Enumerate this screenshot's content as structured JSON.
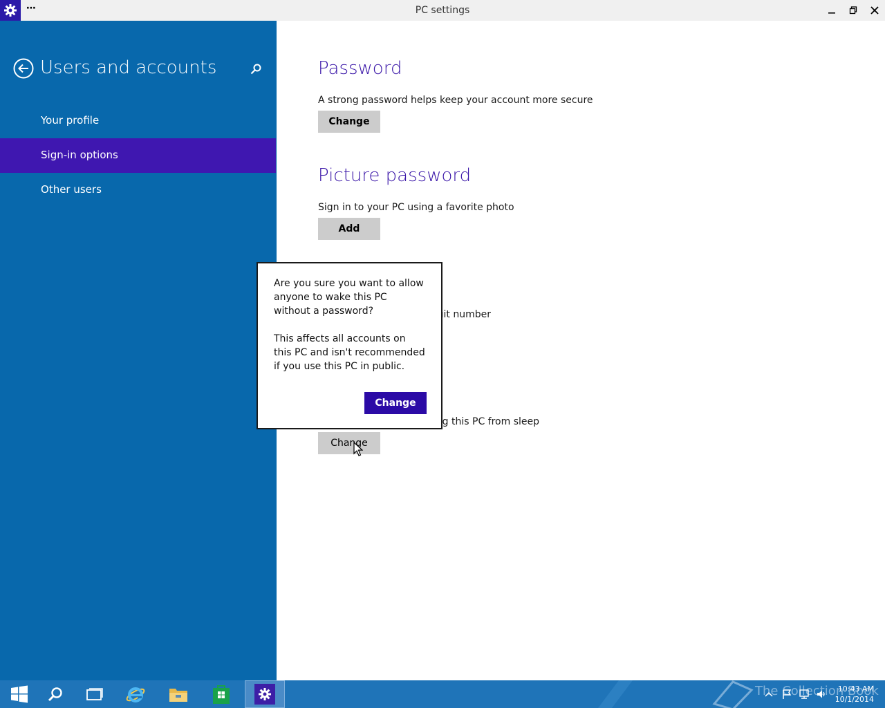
{
  "window": {
    "title": "PC settings",
    "menu_glyph": "⋯"
  },
  "colors": {
    "sidebar": "#0868ac",
    "accent": "#3f17b0",
    "heading": "#3a16a8",
    "dialog_button": "#2b0aa6",
    "taskbar": "#1f74b8"
  },
  "sidebar": {
    "title": "Users and accounts",
    "items": [
      {
        "label": "Your profile",
        "selected": false
      },
      {
        "label": "Sign-in options",
        "selected": true
      },
      {
        "label": "Other users",
        "selected": false
      }
    ]
  },
  "main": {
    "password": {
      "title": "Password",
      "description": "A strong password helps keep your account more secure",
      "button": "Change"
    },
    "picture_password": {
      "title": "Picture password",
      "description": "Sign in to your PC using a favorite photo",
      "button": "Add"
    },
    "pin": {
      "description_partial": "git number"
    },
    "password_policy": {
      "description_partial": "king this PC from sleep",
      "button": "Change"
    }
  },
  "dialog": {
    "message1": "Are you sure you want to allow anyone to wake this PC without a password?",
    "message2": "This affects all accounts on this PC and isn't recommended if you use this PC in public.",
    "button": "Change"
  },
  "taskbar": {
    "icons": [
      "start-icon",
      "search-icon",
      "task-view-icon",
      "internet-explorer-icon",
      "file-explorer-icon",
      "store-icon",
      "pc-settings-icon"
    ],
    "watermark": "The Collection Book",
    "time": "10:43 AM",
    "date": "10/1/2014"
  }
}
